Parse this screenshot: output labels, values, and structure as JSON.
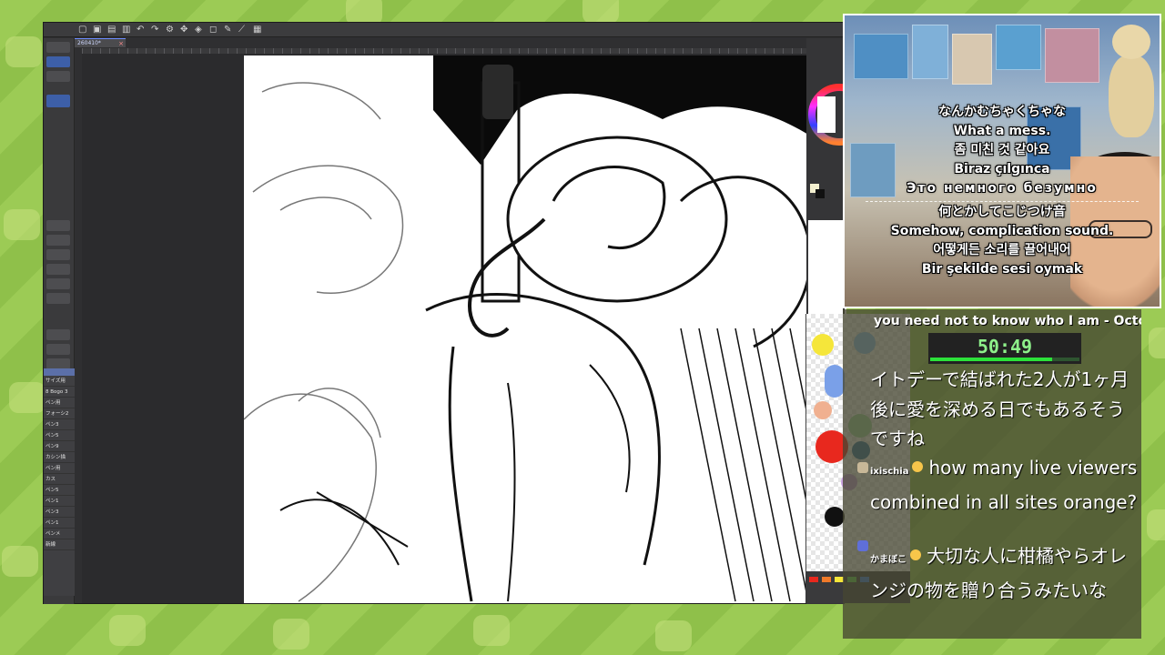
{
  "app": {
    "document_tab": "260410*",
    "sub_tools": [
      "",
      "サイズ用",
      "8 Bogo 3",
      "ペン用",
      "フォーシ2",
      "ペン3",
      "ペン5",
      "ペン9",
      "カシン描",
      "ペン用",
      "カス",
      "ペン5",
      "ペン1",
      "ペン3",
      "ペン1",
      "ペンメ",
      "新線"
    ]
  },
  "webcam": {
    "subtitles_top": [
      "なんかむちゃくちゃな",
      "What a mess.",
      "좀 미친 것 같아요",
      "Biraz çılgınca",
      "Это немного безумно"
    ],
    "subtitles_bottom": [
      "何とかしてこじつけ音",
      "Somehow, complication sound.",
      "어떻게든 소리를 끌어내어",
      "Bir şekilde sesi oymak"
    ]
  },
  "overlay": {
    "now_playing": "you need not to know who I am - Octop",
    "timer": "50:49",
    "timer_progress": 0.82
  },
  "chat": [
    {
      "user": "",
      "text": "イトデーで結ばれた2人が1ヶ月後に愛を深める日でもあるそうですね"
    },
    {
      "user": "ixischia",
      "text": "how many live viewers combined in all sites orange?"
    },
    {
      "user": "かまぼこ",
      "text": "大切な人に柑橘やらオレンジの物を贈り合うみたいな"
    }
  ],
  "colors": {
    "timer_green": "#8ef08a",
    "timer_bar": "#2ce23a",
    "chat_bg": "#46463299",
    "palette": [
      "#f5e63a",
      "#7aa0e8",
      "#f0b090",
      "#e8281e",
      "#2a6e9e",
      "#c9a0e0",
      "#111111",
      "#8fc8ff",
      "#a0d8a0"
    ]
  }
}
